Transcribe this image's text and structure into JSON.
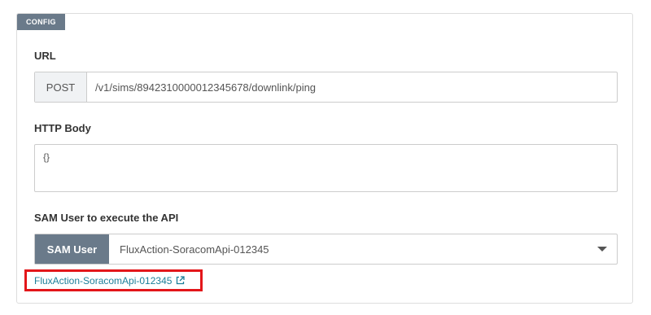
{
  "config": {
    "tag": "CONFIG",
    "url": {
      "label": "URL",
      "method": "POST",
      "value": "/v1/sims/8942310000012345678/downlink/ping"
    },
    "http_body": {
      "label": "HTTP Body",
      "value": "{}"
    },
    "sam_user": {
      "label": "SAM User to execute the API",
      "addon": "SAM User",
      "selected": "FluxAction-SoracomApi-012345",
      "link_text": "FluxAction-SoracomApi-012345"
    }
  },
  "colors": {
    "tag_bg": "#6a7a8a",
    "link": "#1c7f99",
    "highlight": "#e3161a"
  },
  "icons": {
    "external_link": "external-link-icon",
    "dropdown": "caret-down-icon"
  }
}
